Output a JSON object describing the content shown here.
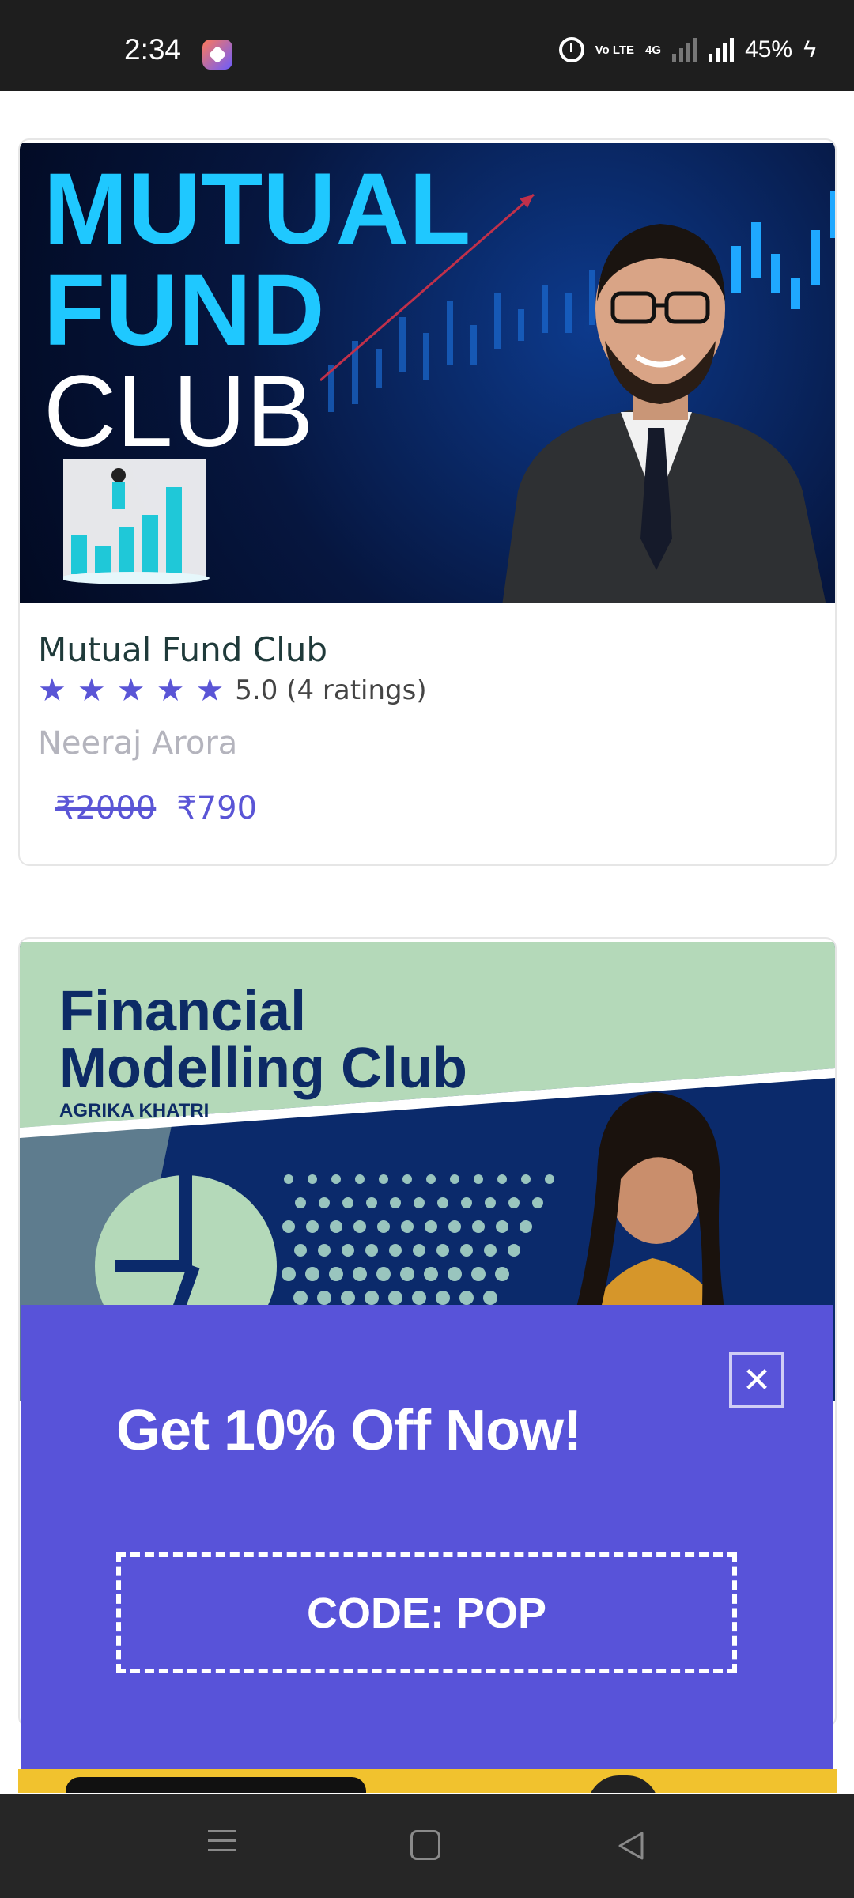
{
  "status_bar": {
    "time": "2:34",
    "volte": "Vo LTE",
    "network": "4G",
    "battery": "45%"
  },
  "courses": [
    {
      "thumbnail_text": [
        "MUTUAL",
        "FUND",
        "CLUB"
      ],
      "title": "Mutual Fund Club",
      "rating_stars": 5,
      "rating_text": "5.0 (4 ratings)",
      "instructor": "Neeraj Arora",
      "old_price": "₹2000",
      "price": "₹790"
    },
    {
      "thumbnail_title_line1": "Financial",
      "thumbnail_title_line2": "Modelling Club",
      "thumbnail_subtitle": "AGRIKA KHATRI"
    }
  ],
  "popup": {
    "heading": "Get 10% Off Now!",
    "code": "CODE: POP",
    "close_symbol": "✕"
  },
  "icons": {
    "star": "star-icon",
    "close": "close-icon",
    "nav_menu": "menu-icon",
    "nav_home": "home-icon",
    "nav_back": "back-icon"
  },
  "colors": {
    "accent": "#5a55d6",
    "popup_bg": "#5853d9",
    "title_cyan": "#1fc8ff"
  }
}
